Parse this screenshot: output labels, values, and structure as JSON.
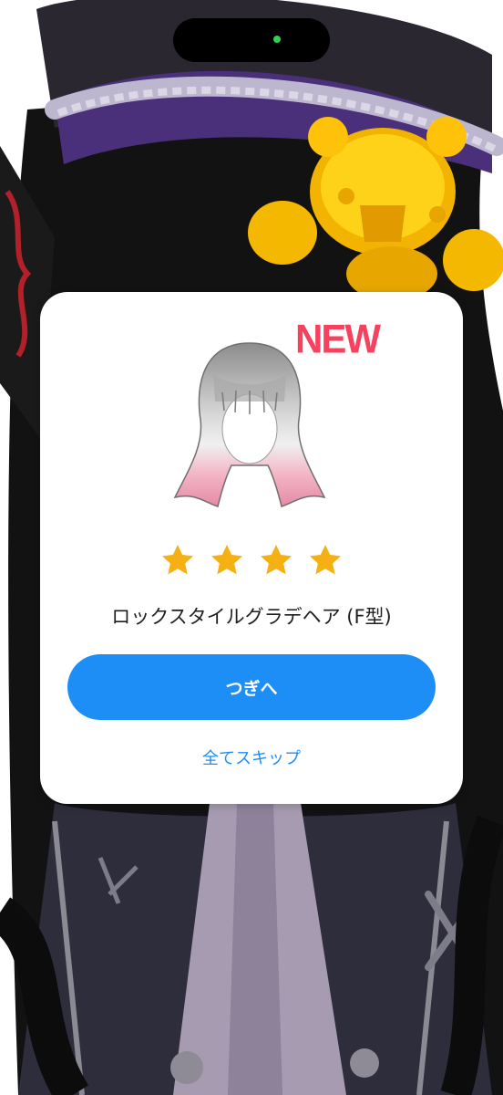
{
  "modal": {
    "badge": "NEW",
    "rarity_stars": 4,
    "item_name": "ロックスタイルグラデヘア (F型)",
    "next_label": "つぎへ",
    "skip_all_label": "全てスキップ",
    "item_image_icon": "hair-icon"
  },
  "colors": {
    "accent": "#1e8ef7",
    "badge": "#f6415f",
    "star": "#f5b014"
  }
}
